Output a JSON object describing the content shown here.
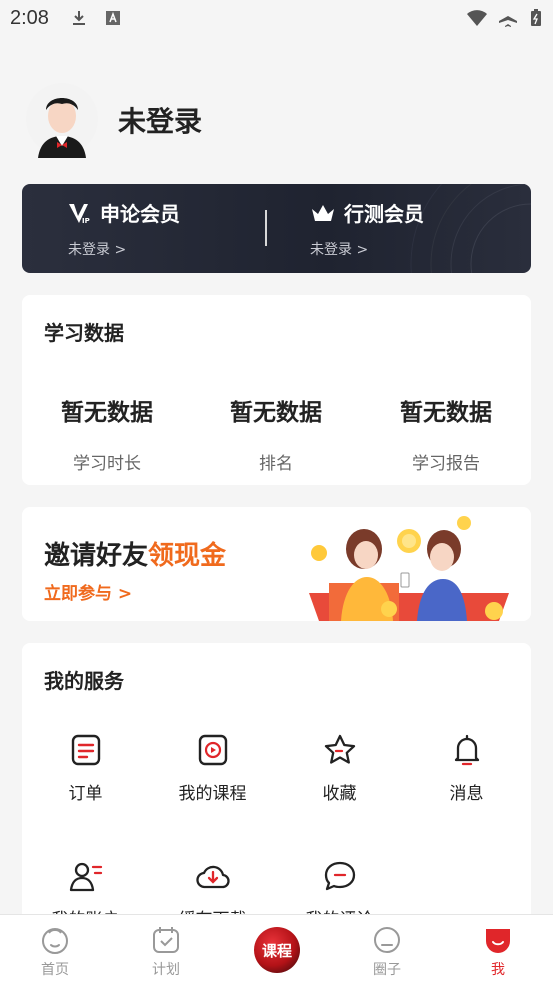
{
  "status_bar": {
    "time": "2:08"
  },
  "profile": {
    "username": "未登录"
  },
  "vip": {
    "left": {
      "title": "申论会员",
      "sub": "未登录 >"
    },
    "right": {
      "title": "行测会员",
      "sub": "未登录 >"
    }
  },
  "study": {
    "title": "学习数据",
    "stats": [
      {
        "value": "暂无数据",
        "label": "学习时长"
      },
      {
        "value": "暂无数据",
        "label": "排名"
      },
      {
        "value": "暂无数据",
        "label": "学习报告"
      }
    ]
  },
  "invite": {
    "headline_a": "邀请好友",
    "headline_b": "领现金",
    "cta": "立即参与 >"
  },
  "services": {
    "title": "我的服务",
    "items": [
      {
        "label": "订单",
        "icon": "order-icon"
      },
      {
        "label": "我的课程",
        "icon": "course-icon"
      },
      {
        "label": "收藏",
        "icon": "star-icon"
      },
      {
        "label": "消息",
        "icon": "bell-icon"
      },
      {
        "label": "我的账户",
        "icon": "account-icon"
      },
      {
        "label": "缓存下载",
        "icon": "cloud-download-icon"
      },
      {
        "label": "我的评论",
        "icon": "comment-icon"
      }
    ]
  },
  "tabbar": {
    "tabs": [
      {
        "label": "首页",
        "icon": "home-face-icon"
      },
      {
        "label": "计划",
        "icon": "plan-icon"
      },
      {
        "label": "课程",
        "icon": "course-center-icon"
      },
      {
        "label": "圈子",
        "icon": "circle-icon"
      },
      {
        "label": "我",
        "icon": "me-icon"
      }
    ]
  },
  "colors": {
    "accent": "#f06a1d",
    "active_tab": "#e0262a",
    "vip_bg": "#1f2330"
  }
}
